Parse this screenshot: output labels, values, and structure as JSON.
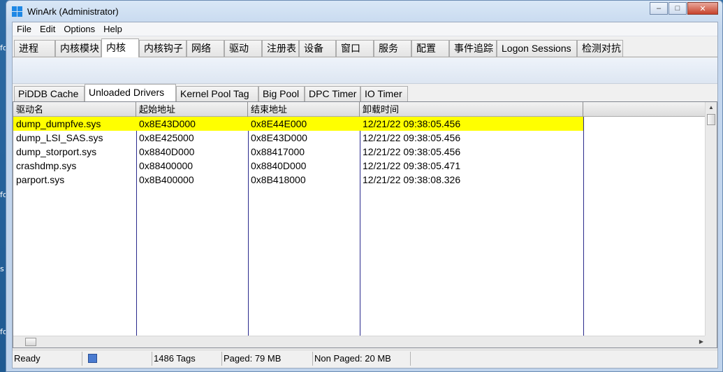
{
  "window": {
    "title": "WinArk  (Administrator)",
    "controls": {
      "minimize": "–",
      "maximize": "□",
      "close": "✕"
    }
  },
  "desktop_fragments": [
    "fo",
    "fo",
    "s",
    "fo"
  ],
  "menu": [
    "File",
    "Edit",
    "Options",
    "Help"
  ],
  "top_tabs": [
    "进程",
    "内核模块",
    "内核",
    "内核钩子",
    "网络",
    "驱动",
    "注册表",
    "设备",
    "窗口",
    "服务",
    "配置",
    "事件追踪",
    "Logon Sessions",
    "检测对抗"
  ],
  "top_tabs_active": "内核",
  "sub_tabs": [
    "PiDDB Cache",
    "Unloaded Drivers",
    "Kernel Pool Tag",
    "Big Pool",
    "DPC Timer",
    "IO Timer"
  ],
  "sub_tabs_active": "Unloaded Drivers",
  "columns": [
    "驱动名",
    "起始地址",
    "结束地址",
    "卸载时间"
  ],
  "rows": [
    [
      "dump_dumpfve.sys",
      "0x8E43D000",
      "0x8E44E000",
      "12/21/22 09:38:05.456"
    ],
    [
      "dump_LSI_SAS.sys",
      "0x8E425000",
      "0x8E43D000",
      "12/21/22 09:38:05.456"
    ],
    [
      "dump_storport.sys",
      "0x8840D000",
      "0x88417000",
      "12/21/22 09:38:05.456"
    ],
    [
      "crashdmp.sys",
      "0x88400000",
      "0x8840D000",
      "12/21/22 09:38:05.471"
    ],
    [
      "parport.sys",
      "0x8B400000",
      "0x8B418000",
      "12/21/22 09:38:08.326"
    ]
  ],
  "selected_row": 0,
  "colors": {
    "selection": "#ffff00",
    "column_divider": "#2a2a8c"
  },
  "status": {
    "ready": "Ready",
    "tags": "1486 Tags",
    "paged": "Paged: 79 MB",
    "nonpaged": "Non Paged: 20 MB"
  }
}
